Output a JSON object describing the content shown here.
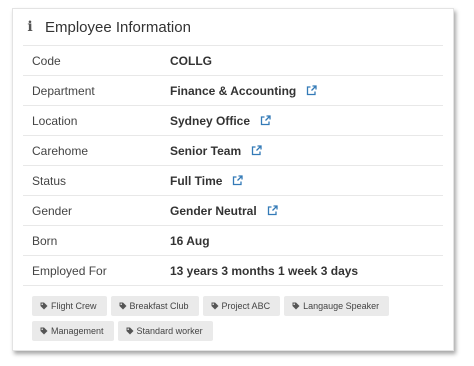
{
  "panel": {
    "title": "Employee Information",
    "icon": "info-icon"
  },
  "rows": [
    {
      "label": "Code",
      "value": "COLLG",
      "link": false
    },
    {
      "label": "Department",
      "value": "Finance & Accounting",
      "link": true
    },
    {
      "label": "Location",
      "value": "Sydney Office",
      "link": true
    },
    {
      "label": "Carehome",
      "value": "Senior Team",
      "link": true
    },
    {
      "label": "Status",
      "value": "Full Time",
      "link": true
    },
    {
      "label": "Gender",
      "value": "Gender Neutral",
      "link": true
    },
    {
      "label": "Born",
      "value": "16 Aug",
      "link": false
    },
    {
      "label": "Employed For",
      "value": "13 years 3 months 1 week 3 days",
      "link": false
    }
  ],
  "tags": [
    "Flight Crew",
    "Breakfast Club",
    "Project ABC",
    "Langauge Speaker",
    "Management",
    "Standard worker"
  ],
  "colors": {
    "link_icon": "#337ab7",
    "tag_background": "#eaeaea",
    "divider": "#e8e8e8"
  },
  "icons": {
    "external_link": "external-link-icon",
    "tag": "tag-icon"
  }
}
